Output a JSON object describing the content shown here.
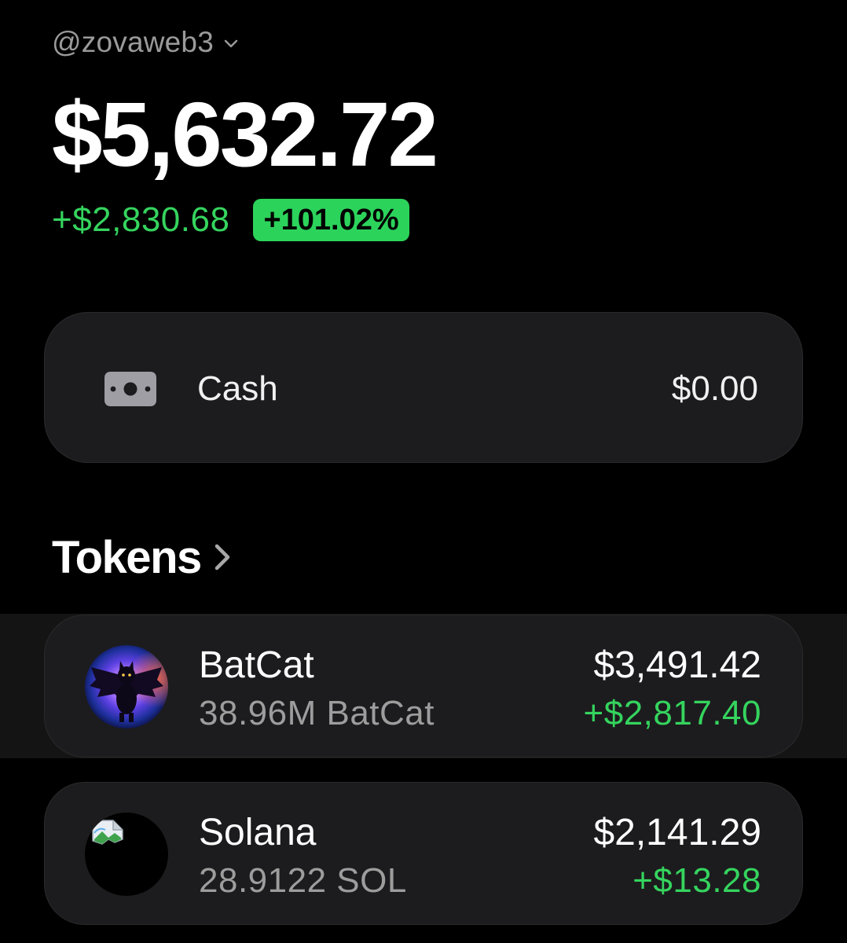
{
  "account": {
    "handle": "@zovaweb3",
    "switcher_icon": "chevron-down-icon"
  },
  "portfolio": {
    "balance": "$5,632.72",
    "change_amount": "+$2,830.68",
    "change_percent": "+101.02%"
  },
  "cash": {
    "icon": "cash-icon",
    "label": "Cash",
    "value": "$0.00"
  },
  "tokens_section": {
    "title": "Tokens",
    "icon": "chevron-right-icon"
  },
  "tokens": [
    {
      "name": "BatCat",
      "amount": "38.96M BatCat",
      "value": "$3,491.42",
      "change": "+$2,817.40",
      "icon": "batcat-avatar"
    },
    {
      "name": "Solana",
      "amount": "28.9122 SOL",
      "value": "$2,141.29",
      "change": "+$13.28",
      "icon": "broken-image-icon"
    }
  ],
  "colors": {
    "background": "#000000",
    "card": "#1c1c1e",
    "positive": "#35d45e",
    "badge": "#2cd35b",
    "muted": "#9d9d9d"
  }
}
